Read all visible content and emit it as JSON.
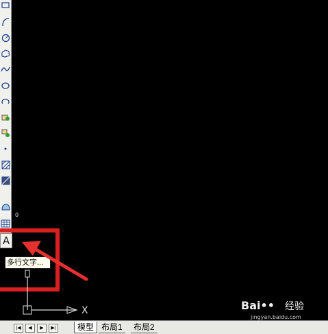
{
  "toolbar": {
    "tools": [
      {
        "icon": "rectangle-icon"
      },
      {
        "icon": "arc-icon"
      },
      {
        "icon": "circle-icon"
      },
      {
        "icon": "revision-cloud-icon"
      },
      {
        "icon": "spline-icon"
      },
      {
        "icon": "ellipse-icon"
      },
      {
        "icon": "ellipse-arc-icon"
      },
      {
        "icon": "insert-block-icon"
      },
      {
        "icon": "make-block-icon"
      },
      {
        "icon": "point-icon"
      },
      {
        "icon": "hatch-icon"
      },
      {
        "icon": "gradient-icon"
      },
      {
        "icon": "region-icon"
      },
      {
        "icon": "table-icon"
      }
    ],
    "text_button_label": "A"
  },
  "canvas": {
    "origin_mark": "0",
    "axis_label": "X"
  },
  "tooltip": {
    "text": "多行文字..."
  },
  "highlight": {
    "color": "#d82020"
  },
  "watermark": {
    "logo": "Bai••",
    "name": "经验",
    "url": "jingyan.baidu.com"
  },
  "statusbar": {
    "nav_buttons": [
      "|◀",
      "◀",
      "▶",
      "▶|"
    ],
    "tabs": [
      {
        "label": "模型",
        "active": true
      },
      {
        "label": "布局1",
        "active": false
      },
      {
        "label": "布局2",
        "active": false
      }
    ]
  }
}
